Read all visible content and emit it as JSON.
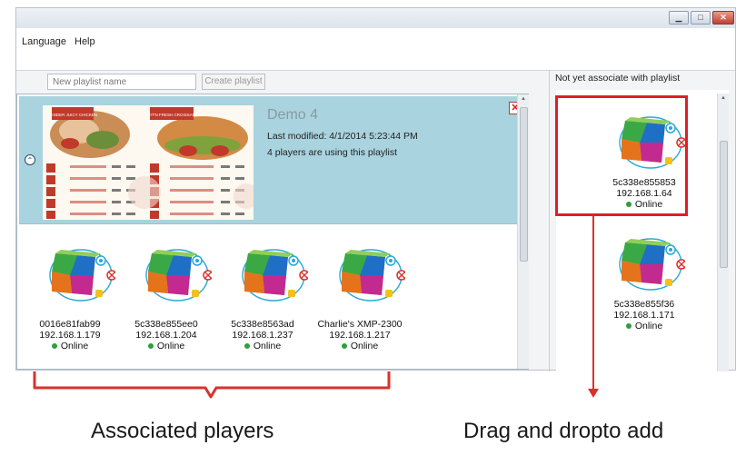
{
  "window": {
    "menu": [
      "Language",
      "Help"
    ]
  },
  "toolbar": {
    "new_playlist_placeholder": "New playlist name",
    "create_button": "Create playlist"
  },
  "playlist": {
    "title": "Demo 4",
    "last_modified": "Last modified: 4/1/2014 5:23:44 PM",
    "usage": "4 players are using this playlist",
    "menu_image": {
      "left_banner": "TENDER JUICY CHICKEN",
      "right_banner": "HOT'N FRESH CROISSANT"
    }
  },
  "associated_players": [
    {
      "name": "0016e81fab99",
      "ip": "192.168.1.179",
      "status": "Online"
    },
    {
      "name": "5c338e855ee0",
      "ip": "192.168.1.204",
      "status": "Online"
    },
    {
      "name": "5c338e8563ad",
      "ip": "192.168.1.237",
      "status": "Online"
    },
    {
      "name": "Charlie's XMP-2300",
      "ip": "192.168.1.217",
      "status": "Online"
    }
  ],
  "unassociated": {
    "header": "Not yet associate with playlist",
    "players": [
      {
        "name": "5c338e855853",
        "ip": "192.168.1.64",
        "status": "Online"
      },
      {
        "name": "5c338e855f36",
        "ip": "192.168.1.171",
        "status": "Online"
      }
    ]
  },
  "annotations": {
    "associated": "Associated players",
    "drag": "Drag and dropto add"
  },
  "colors": {
    "accent_red": "#e21d25",
    "online_green": "#2e9e3e",
    "playlist_bg": "#a9d3de"
  }
}
